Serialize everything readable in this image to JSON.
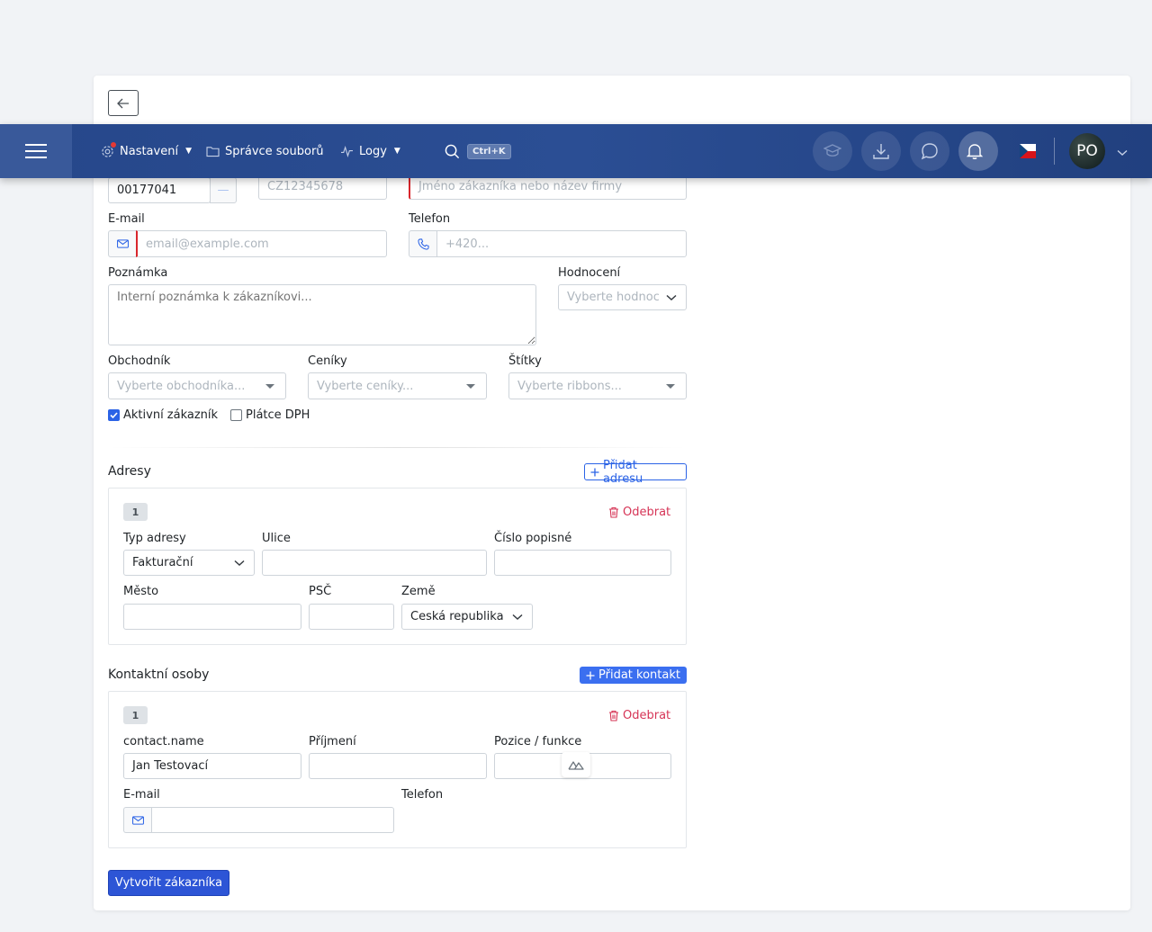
{
  "nav": {
    "settings_label": "Nastavení",
    "file_manager_label": "Správce souborů",
    "logs_label": "Logy",
    "search_shortcut": "Ctrl+K",
    "avatar_initials": "PO",
    "language": "CZ"
  },
  "form": {
    "ico_value": "00177041",
    "ico_button": "—",
    "dic_placeholder": "CZ12345678",
    "name_placeholder": "Jméno zákazníka nebo název firmy",
    "email_label": "E-mail",
    "email_placeholder": "email@example.com",
    "phone_label": "Telefon",
    "phone_placeholder": "+420...",
    "note_label": "Poznámka",
    "note_placeholder": "Interní poznámka k zákazníkovi...",
    "rating_label": "Hodnocení",
    "rating_placeholder": "Vyberte hodnocení",
    "salesman_label": "Obchodník",
    "salesman_placeholder": "Vyberte obchodníka...",
    "pricelists_label": "Ceníky",
    "pricelists_placeholder": "Vyberte ceníky...",
    "tags_label": "Štítky",
    "tags_placeholder": "Vyberte ribbons...",
    "active_label": "Aktivní zákazník",
    "active_checked": true,
    "vat_label": "Plátce DPH",
    "vat_checked": false
  },
  "addresses": {
    "title": "Adresy",
    "add_label": "Přidat adresu",
    "items": [
      {
        "index": "1",
        "remove_label": "Odebrat",
        "type_label": "Typ adresy",
        "type_value": "Fakturační",
        "street_label": "Ulice",
        "street_value": "",
        "number_label": "Číslo popisné",
        "number_value": "",
        "city_label": "Město",
        "city_value": "",
        "zip_label": "PSČ",
        "zip_value": "",
        "country_label": "Země",
        "country_value": "Česká republika"
      }
    ]
  },
  "contacts": {
    "title": "Kontaktní osoby",
    "add_label": "Přidat kontakt",
    "items": [
      {
        "index": "1",
        "remove_label": "Odebrat",
        "name_label": "contact.name",
        "name_value": "Jan Testovací",
        "surname_label": "Příjmení",
        "surname_value": "",
        "position_label": "Pozice / funkce",
        "position_value": "",
        "email_label": "E-mail",
        "email_value": "",
        "phone_label": "Telefon"
      }
    ]
  },
  "submit_label": "Vytvořit zákazníka",
  "colors": {
    "navbar": "#2b4e94",
    "primary": "#2b63e6",
    "danger": "#d63456",
    "submit": "#2d55d6"
  }
}
